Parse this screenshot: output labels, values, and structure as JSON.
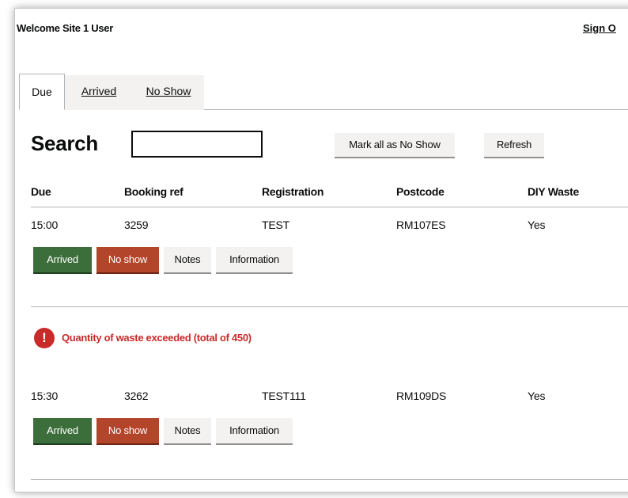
{
  "header": {
    "welcome": "Welcome Site 1 User",
    "sign_out": "Sign O"
  },
  "tabs": [
    {
      "label": "Due",
      "active": true
    },
    {
      "label": "Arrived",
      "active": false
    },
    {
      "label": "No Show",
      "active": false
    }
  ],
  "search": {
    "label": "Search",
    "value": "",
    "placeholder": ""
  },
  "toolbar": {
    "mark_all_label": "Mark all as No Show",
    "refresh_label": "Refresh"
  },
  "table": {
    "columns": [
      "Due",
      "Booking ref",
      "Registration",
      "Postcode",
      "DIY Waste"
    ],
    "rows": [
      {
        "due": "15:00",
        "booking_ref": "3259",
        "registration": "TEST",
        "postcode": "RM107ES",
        "diy_waste": "Yes",
        "actions": {
          "arrived": "Arrived",
          "no_show": "No show",
          "notes": "Notes",
          "information": "Information"
        }
      },
      {
        "warning": "Quantity of waste exceeded (total of 450)",
        "warning_icon": "!",
        "due": "15:30",
        "booking_ref": "3262",
        "registration": "TEST111",
        "postcode": "RM109DS",
        "diy_waste": "Yes",
        "actions": {
          "arrived": "Arrived",
          "no_show": "No show",
          "notes": "Notes",
          "information": "Information"
        }
      }
    ]
  },
  "colors": {
    "arrived": "#3b6e3a",
    "no_show": "#b3452a",
    "warning": "#c92a2a",
    "secondary_button": "#f3f2f1"
  }
}
